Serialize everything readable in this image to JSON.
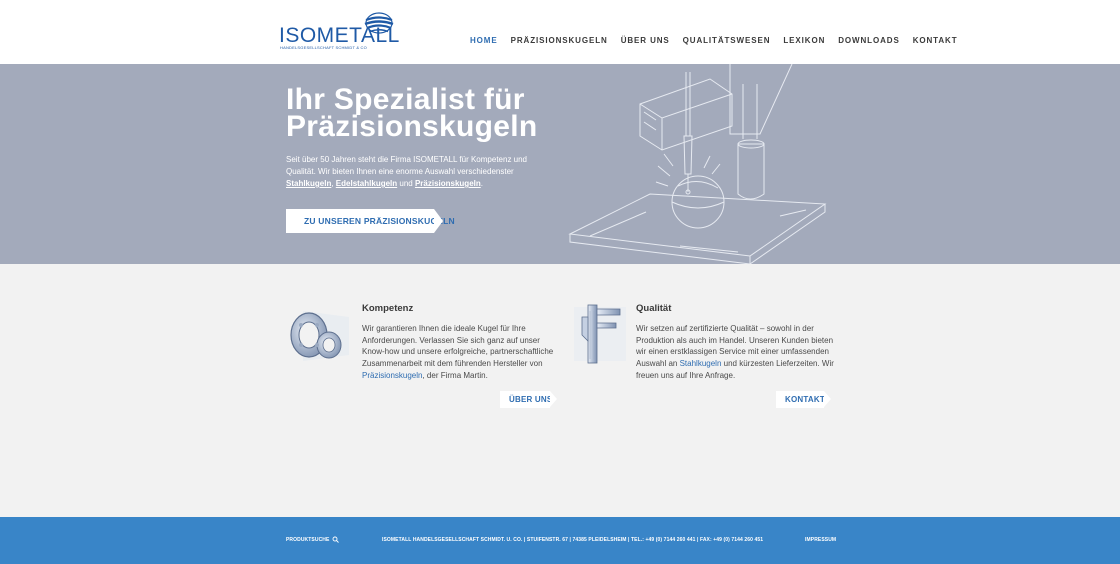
{
  "logo": {
    "wordmark": "ISOMETALL",
    "subline": "HANDELSGESELLSCHAFT SCHMIDT & CO"
  },
  "nav": {
    "items": [
      {
        "label": "HOME",
        "active": true
      },
      {
        "label": "PRÄZISIONSKUGELN",
        "active": false
      },
      {
        "label": "ÜBER UNS",
        "active": false
      },
      {
        "label": "QUALITÄTSWESEN",
        "active": false
      },
      {
        "label": "LEXIKON",
        "active": false
      },
      {
        "label": "DOWNLOADS",
        "active": false
      },
      {
        "label": "KONTAKT",
        "active": false
      }
    ]
  },
  "hero": {
    "title": "Ihr Spezialist für Präzisionskugeln",
    "text_intro": "Seit über 50 Jahren steht die Firma ISOMETALL für Kompetenz und Qualität. Wir bieten Ihnen eine enorme Auswahl verschiedenster ",
    "link_1": "Stahlkugeln",
    "sep_1": ", ",
    "link_2": "Edelstahlkugeln",
    "sep_2": " und ",
    "link_3": "Präzisionskugeln",
    "end": ".",
    "button": "ZU UNSEREN PRÄZISIONSKUGELN",
    "bg_color": "#a3aabb"
  },
  "kompetenz": {
    "icon": "ball-bearing-icon",
    "heading": "Kompetenz",
    "text": "Wir garantieren Ihnen die ideale Kugel für Ihre Anforderungen. Verlassen Sie sich ganz auf unser Know-how und unsere erfolgreiche, partnerschaftliche Zusammenarbeit mit dem führenden Hersteller von ",
    "link": "Präzisionskugeln",
    "text_end": ", der Firma Martin.",
    "button": "ÜBER UNS"
  },
  "qualitaet": {
    "icon": "caliper-icon",
    "heading": "Qualität",
    "text": "Wir setzen auf zertifizierte Qualität – sowohl in der Produktion als auch im Handel. Unseren Kunden bieten wir einen erstklassigen Service mit einer umfassenden Auswahl an ",
    "link": "Stahlkugeln",
    "text_end": " und kürzesten Lieferzeiten. Wir freuen uns auf Ihre Anfrage.",
    "button": "KONTAKT"
  },
  "footer": {
    "search_label": "PRODUKTSUCHE",
    "search_icon": "search-icon",
    "company": "ISOMETALL HANDELSGESELLSCHAFT SCHMIDT. U. CO. | STUIFENSTR. 67 | 74385 PLEIDELSHEIM | TEL.: +49 (0) 7144 260 441 | FAX: +49 (0) 7144 260 451",
    "impressum": "IMPRESSUM",
    "bg_color": "#3985c8"
  }
}
